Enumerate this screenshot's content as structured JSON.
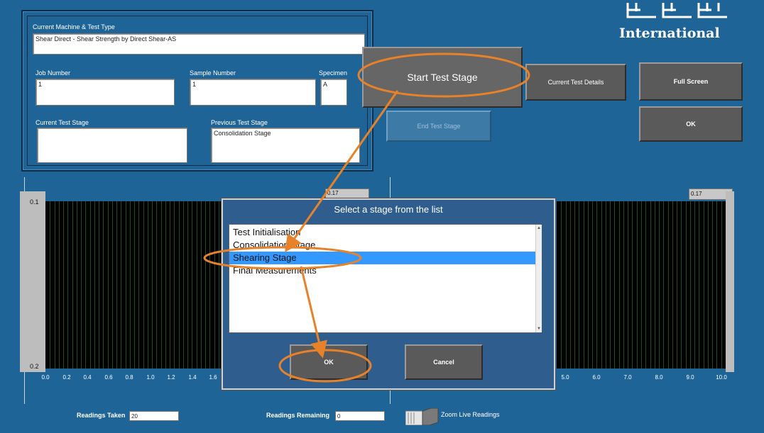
{
  "logo": {
    "text": "International"
  },
  "top_panel": {
    "machine_label": "Current Machine & Test Type",
    "machine_value": "Shear Direct   -   Shear Strength by Direct Shear-AS",
    "job_label": "Job Number",
    "job_value": "1",
    "sample_label": "Sample Number",
    "sample_value": "1",
    "specimen_label": "Specimen",
    "specimen_value": "A",
    "current_stage_label": "Current Test Stage",
    "current_stage_value": "",
    "previous_stage_label": "Previous Test Stage",
    "previous_stage_value": "Consolidation Stage"
  },
  "buttons": {
    "start_test_stage": "Start Test Stage",
    "current_test_details": "Current Test Details",
    "full_screen": "Full Screen",
    "end_test_stage": "End Test Stage",
    "ok": "OK"
  },
  "chart_left": {
    "y_top": "0.1",
    "y_bottom": "0.2",
    "readout": "0.17",
    "x_ticks": [
      "0.0",
      "0.2",
      "0.4",
      "0.6",
      "0.8",
      "1.0",
      "1.2",
      "1.4",
      "1.6"
    ]
  },
  "chart_right": {
    "readout": "0.17",
    "x_ticks": [
      "5.0",
      "6.0",
      "7.0",
      "8.0",
      "9.0",
      "10.0"
    ]
  },
  "dialog": {
    "title": "Select a stage from the list",
    "items": [
      "Test Initialisation",
      "Consolidation Stage",
      "Shearing Stage",
      "Final Measurements"
    ],
    "selected_index": 2,
    "ok_label": "OK",
    "cancel_label": "Cancel"
  },
  "footer": {
    "readings_taken_label": "Readings Taken",
    "readings_taken_value": "20",
    "readings_remaining_label": "Readings Remaining",
    "readings_remaining_value": "0",
    "zoom_label": "Zoom Live Readings"
  },
  "colors": {
    "background": "#1f6496",
    "annotation": "#e8822a",
    "selection": "#3399ff"
  }
}
